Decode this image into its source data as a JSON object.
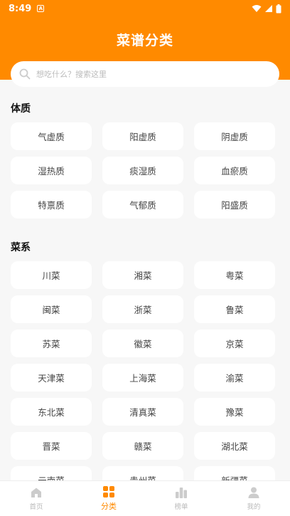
{
  "status_bar": {
    "time": "8:49",
    "notification_glyph": "A"
  },
  "header": {
    "title": "菜谱分类"
  },
  "search": {
    "placeholder": "想吃什么？搜索这里"
  },
  "sections": [
    {
      "title": "体质",
      "items": [
        "气虚质",
        "阳虚质",
        "阴虚质",
        "湿热质",
        "痰湿质",
        "血瘀质",
        "特禀质",
        "气郁质",
        "阳盛质"
      ]
    },
    {
      "title": "菜系",
      "items": [
        "川菜",
        "湘菜",
        "粤菜",
        "闽菜",
        "浙菜",
        "鲁菜",
        "苏菜",
        "徽菜",
        "京菜",
        "天津菜",
        "上海菜",
        "渝菜",
        "东北菜",
        "清真菜",
        "豫菜",
        "晋菜",
        "赣菜",
        "湖北菜",
        "云南菜",
        "贵州菜",
        "新疆菜"
      ]
    }
  ],
  "tabbar": {
    "items": [
      {
        "label": "首页",
        "icon": "home-icon",
        "active": false
      },
      {
        "label": "分类",
        "icon": "grid-icon",
        "active": true
      },
      {
        "label": "榜单",
        "icon": "ranking-icon",
        "active": false
      },
      {
        "label": "我的",
        "icon": "user-icon",
        "active": false
      }
    ]
  },
  "colors": {
    "accent": "#ff8a00",
    "background": "#f7f7f7",
    "chip": "#ffffff",
    "inactive": "#bbbbbb"
  }
}
